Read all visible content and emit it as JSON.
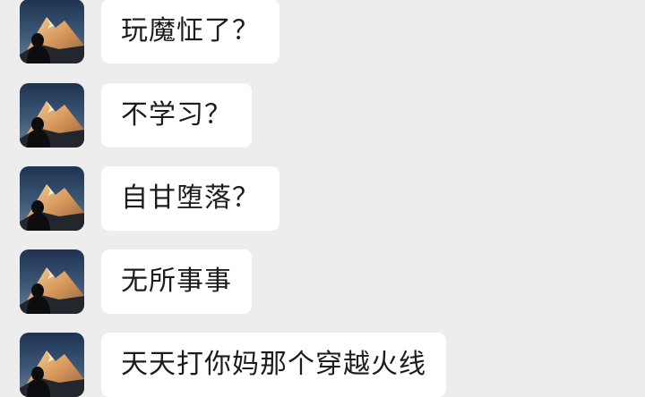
{
  "messages": [
    {
      "text": "玩魔怔了？",
      "avatar_icon": "mountain-avatar-icon"
    },
    {
      "text": "不学习？",
      "avatar_icon": "mountain-avatar-icon"
    },
    {
      "text": "自甘堕落？",
      "avatar_icon": "mountain-avatar-icon"
    },
    {
      "text": "无所事事",
      "avatar_icon": "mountain-avatar-icon"
    },
    {
      "text": "天天打你妈那个穿越火线",
      "avatar_icon": "mountain-avatar-icon"
    }
  ],
  "colors": {
    "background": "#ededed",
    "bubble": "#ffffff",
    "text": "#1c1c1c"
  }
}
